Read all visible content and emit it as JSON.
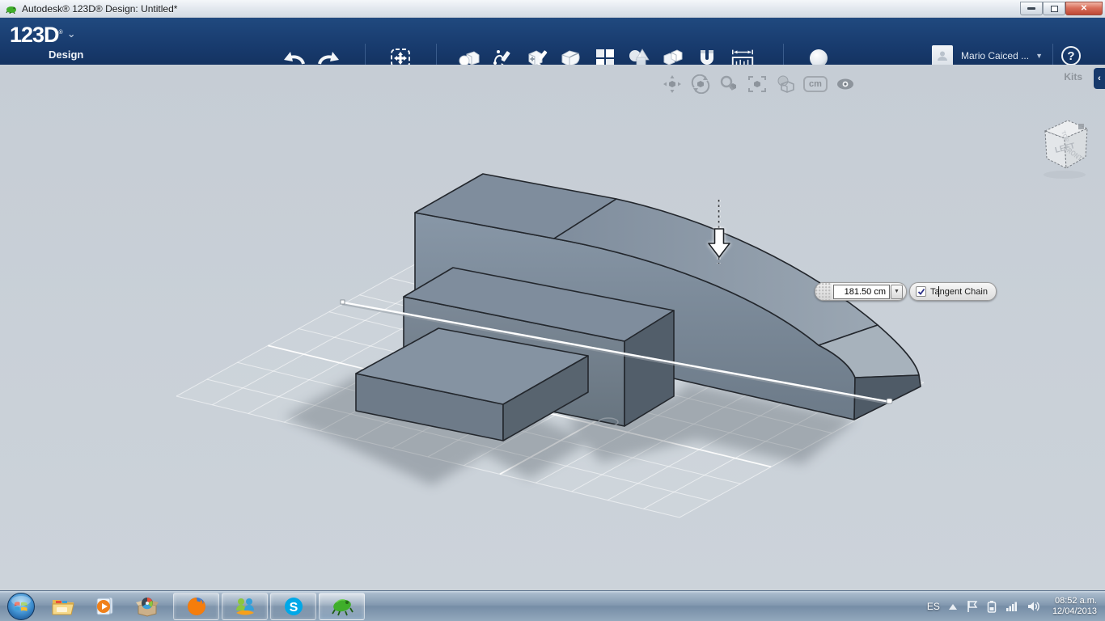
{
  "title_bar": {
    "title": "Autodesk® 123D® Design: Untitled*"
  },
  "app_bar": {
    "logo": "123D",
    "logo_reg": "®",
    "logo_sub": "Design",
    "logo_chevron": "⌄",
    "user_name": "Mario Caiced ...",
    "help_label": "?",
    "tools": [
      "undo",
      "redo",
      "transform",
      "primitives",
      "sketch",
      "construct",
      "modify",
      "pattern",
      "combine",
      "group",
      "snap",
      "measure",
      "material"
    ]
  },
  "view_toolbar": {
    "unit": "cm",
    "icons": [
      "pan",
      "orbit",
      "zoom",
      "fit",
      "shaded-view",
      "unit",
      "visibility"
    ]
  },
  "right_panel": {
    "label": "Kits"
  },
  "view_cube": {
    "top": "TOP",
    "left": "LEFT",
    "front": "FRONT"
  },
  "dimension_widget": {
    "value": "181.50 cm",
    "option_label": "Tangent Chain",
    "checked": true
  },
  "taskbar": {
    "language": "ES",
    "time": "08:52 a.m.",
    "date": "12/04/2013",
    "apps": [
      "start",
      "explorer",
      "media-player",
      "box-app",
      "firefox",
      "messenger",
      "skype",
      "123d-design"
    ]
  },
  "colors": {
    "appbar_navy": "#17396b",
    "canvas": "#c9d0d8",
    "model_top": "#7f8d9d",
    "model_front": "#75828f"
  }
}
